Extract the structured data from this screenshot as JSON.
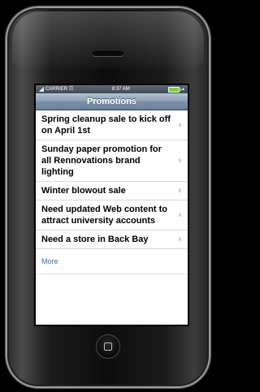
{
  "status_bar": {
    "carrier": "CARRIER",
    "time": "8:37 AM",
    "icons": [
      "signal-icon",
      "wifi-icon",
      "battery-icon",
      "lock-arrow-icon"
    ]
  },
  "nav": {
    "title": "Promotions"
  },
  "list": {
    "items": [
      {
        "label": "Spring cleanup sale to kick off on April 1st"
      },
      {
        "label": "Sunday paper promotion for all Rennovations brand lighting"
      },
      {
        "label": "Winter blowout sale"
      },
      {
        "label": "Need updated Web content to attract university accounts"
      },
      {
        "label": "Need a store in Back Bay"
      }
    ],
    "chevron": "›"
  },
  "more_link": "More",
  "colors": {
    "nav_bar": "#7a8ea8",
    "link": "#3d6dbb",
    "chevron": "#8c8c8c"
  }
}
